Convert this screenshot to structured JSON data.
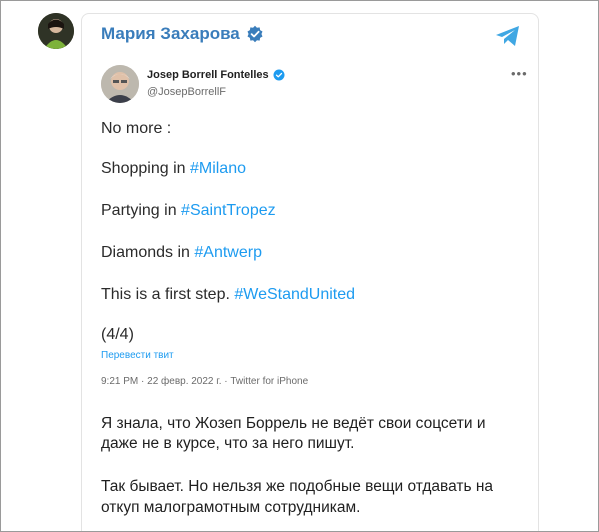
{
  "channel": {
    "name": "Мария Захарова",
    "verified_color": "#3a7dbb",
    "telegram_color": "#40a7e3"
  },
  "tweet": {
    "author_name": "Josep Borrell Fontelles",
    "handle": "@JosepBorrellF",
    "more_icon": "more-dots-icon",
    "lines": [
      {
        "text": "No more :",
        "hashtag": ""
      },
      {
        "text": "Shopping in ",
        "hashtag": "#Milano"
      },
      {
        "text": "Partying in ",
        "hashtag": "#SaintTropez"
      },
      {
        "text": "Diamonds in ",
        "hashtag": "#Antwerp"
      },
      {
        "text": "This is a first step. ",
        "hashtag": "#WeStandUnited"
      },
      {
        "text": "(4/4)",
        "hashtag": ""
      }
    ],
    "translate_label": "Перевести твит",
    "meta": "9:21 PM · 22 февр. 2022 г. · Twitter for iPhone",
    "hashtag_color": "#1d9bf0"
  },
  "message": {
    "lines": [
      "Я знала, что Жозеп Боррель не ведёт свои соцсети и",
      "даже не в курсе, что за него пишут.",
      "Так бывает. Но нельзя же подобные вещи отдавать на",
      "откуп малограмотным сотрудникам."
    ]
  }
}
